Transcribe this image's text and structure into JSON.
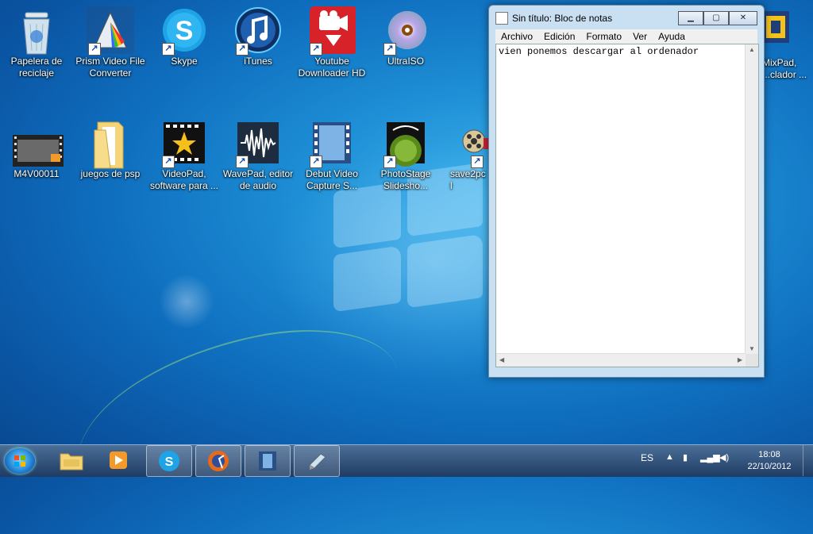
{
  "desktop": {
    "icons": [
      {
        "label": "Papelera de reciclaje",
        "icon": "recycle-bin-icon"
      },
      {
        "label": "Prism Video File Converter",
        "icon": "prism-icon"
      },
      {
        "label": "Skype",
        "icon": "skype-icon"
      },
      {
        "label": "iTunes",
        "icon": "itunes-icon"
      },
      {
        "label": "Youtube Downloader HD",
        "icon": "youtube-downloader-icon"
      },
      {
        "label": "UltraISO",
        "icon": "ultraiso-icon"
      },
      {
        "label": "M4V00011",
        "icon": "video-file-icon"
      },
      {
        "label": "juegos de psp",
        "icon": "folder-icon"
      },
      {
        "label": "VideoPad, software para ...",
        "icon": "videopad-icon"
      },
      {
        "label": "WavePad, editor de audio",
        "icon": "wavepad-icon"
      },
      {
        "label": "Debut Video Capture S...",
        "icon": "debut-icon"
      },
      {
        "label": "PhotoStage Slidesho...",
        "icon": "photostage-icon"
      },
      {
        "label": "save2pc l",
        "icon": "save2pc-icon"
      },
      {
        "label": "MixPad, ...clador ...",
        "icon": "mixpad-icon"
      }
    ]
  },
  "notepad": {
    "title": "Sin título: Bloc de notas",
    "menu": [
      "Archivo",
      "Edición",
      "Formato",
      "Ver",
      "Ayuda"
    ],
    "content": "vien ponemos descargar al ordenador"
  },
  "taskbar": {
    "language": "ES",
    "time": "18:08",
    "date": "22/10/2012"
  }
}
